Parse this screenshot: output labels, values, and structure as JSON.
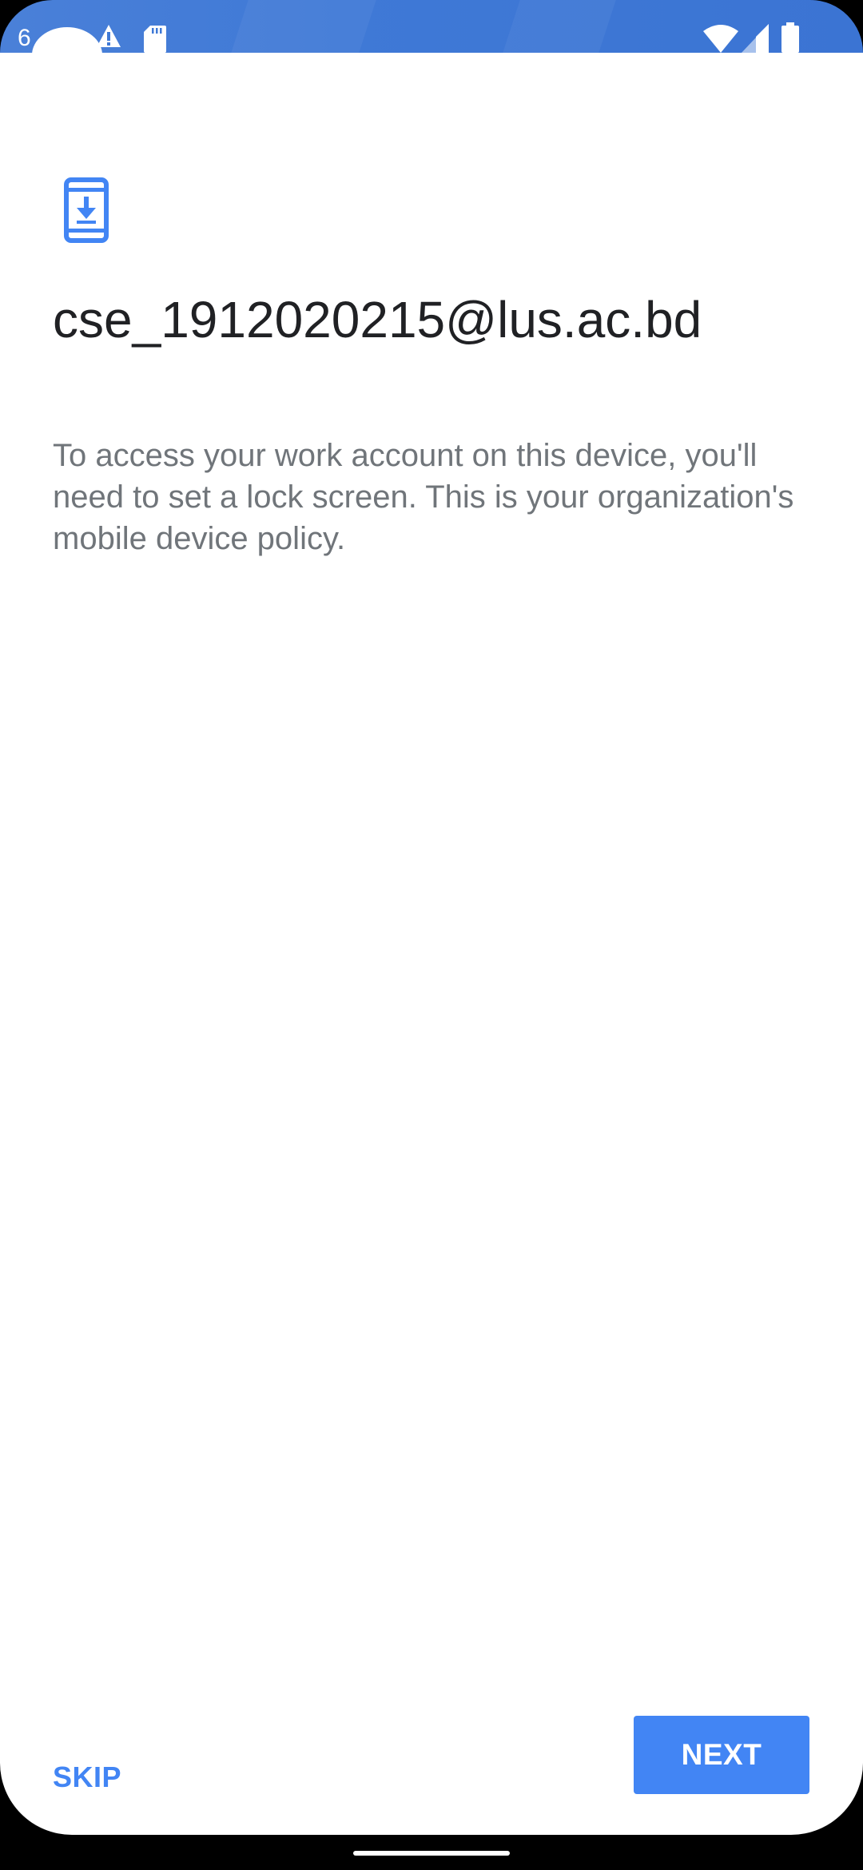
{
  "status_bar": {
    "time": "6",
    "icons": [
      "alert-icon",
      "sd-card-icon",
      "wifi-icon",
      "signal-icon",
      "battery-icon"
    ],
    "background_color": "#3f79d6"
  },
  "screen": {
    "header_icon": "phone-download-icon",
    "account_email": "cse_1912020215@lus.ac.bd",
    "description": "To access your work account on this device, you'll need to set a lock screen. This is your organization's mobile device policy."
  },
  "actions": {
    "skip_label": "SKIP",
    "next_label": "NEXT"
  },
  "colors": {
    "accent": "#4285f4",
    "title_text": "#202124",
    "body_text": "#70757a"
  }
}
